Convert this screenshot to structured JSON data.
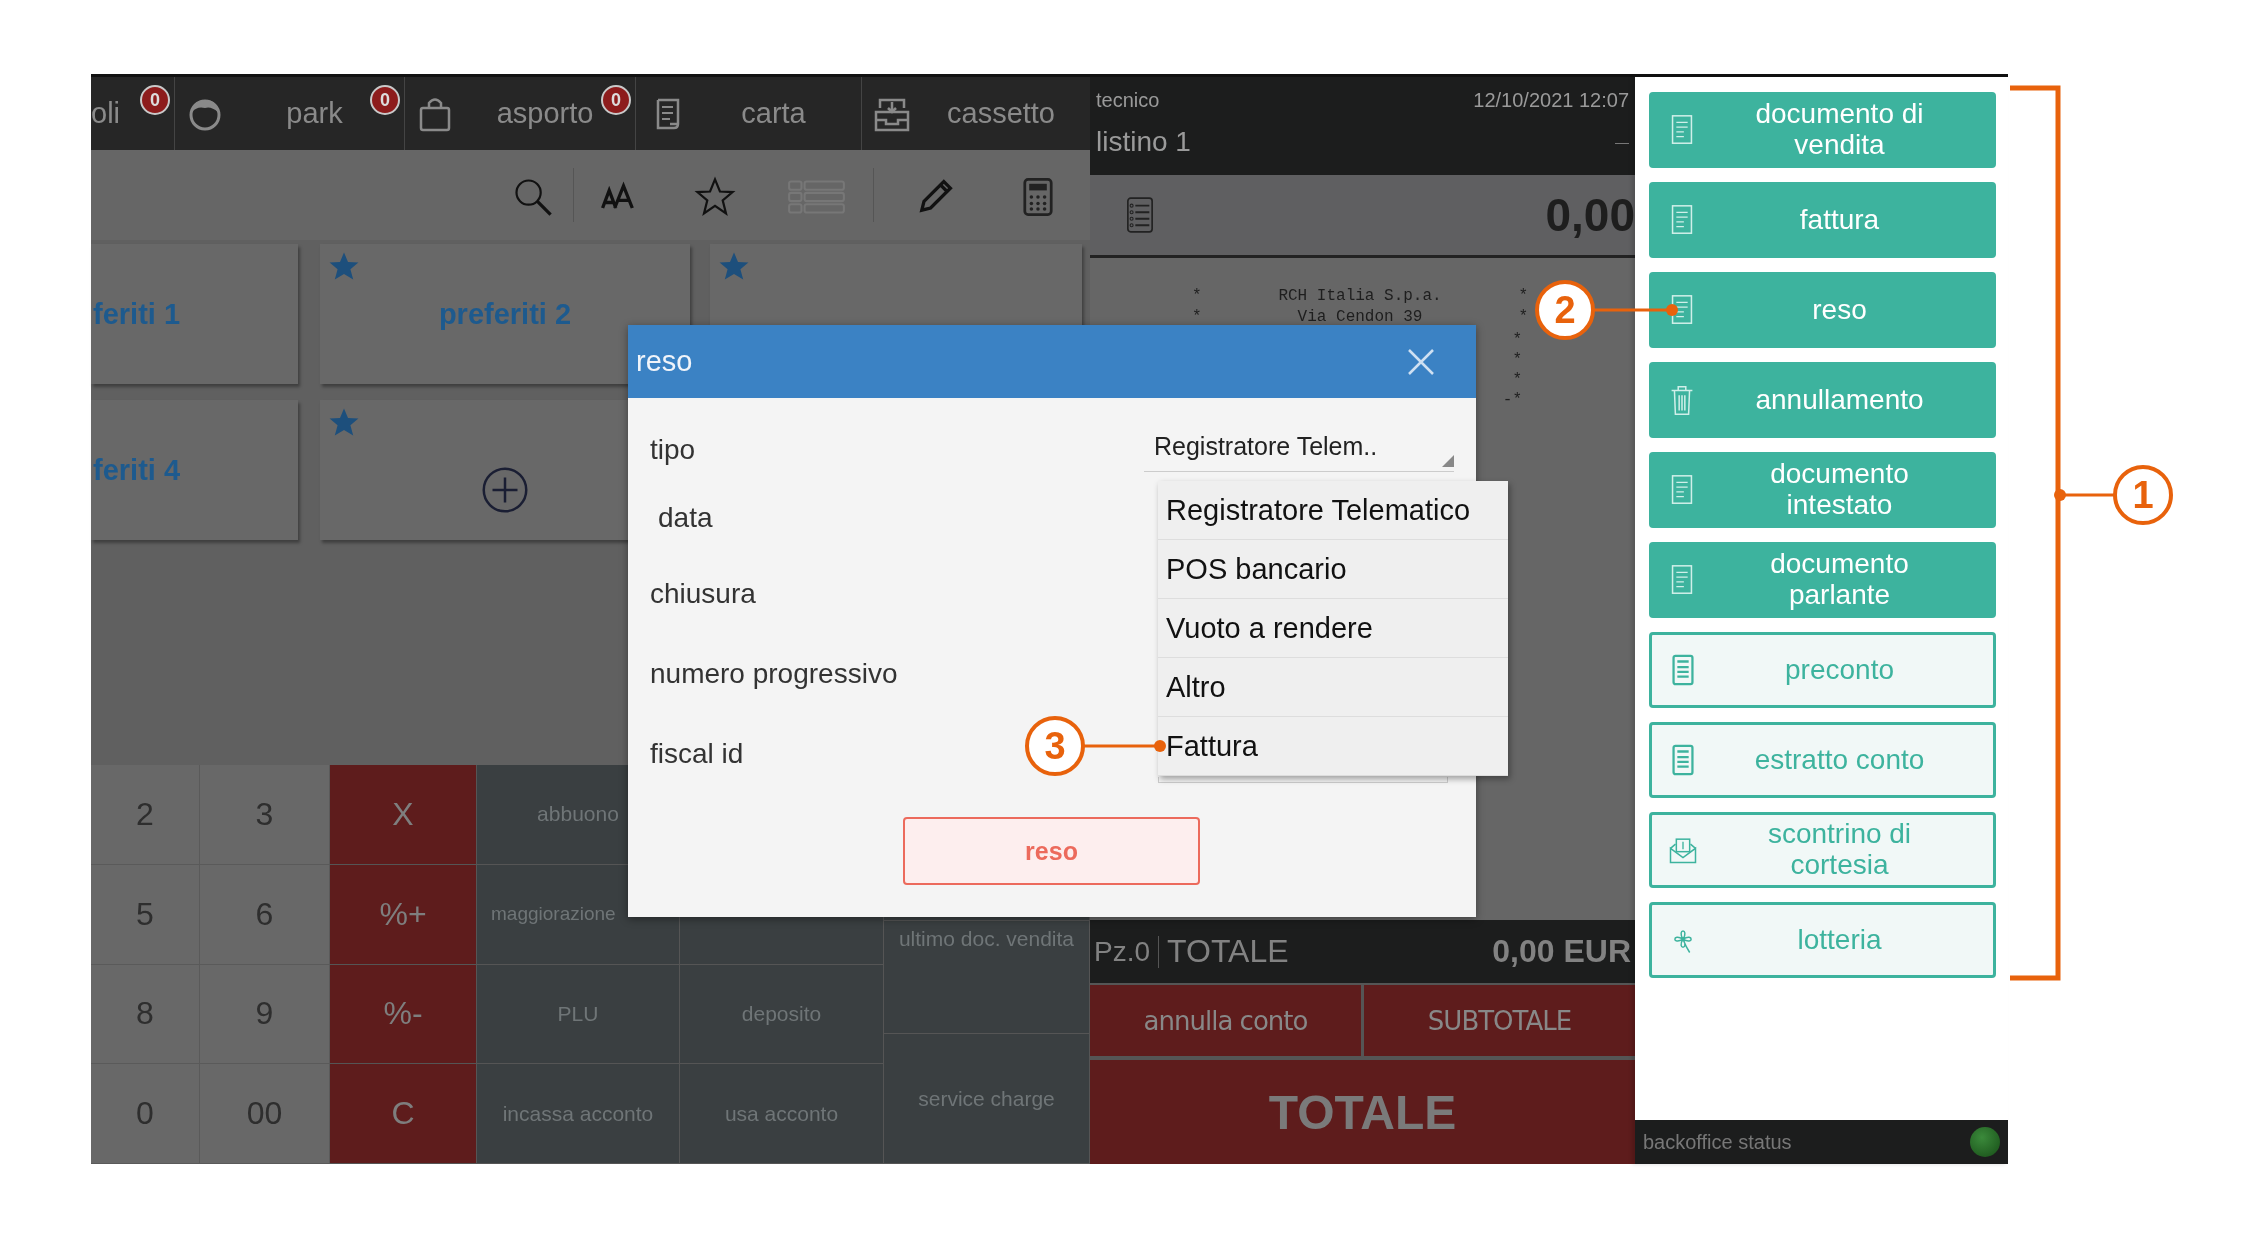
{
  "top_bar": {
    "tabs": [
      {
        "label": "oli",
        "badge": "0"
      },
      {
        "label": "park",
        "badge": "0"
      },
      {
        "label": "asporto",
        "badge": "0"
      },
      {
        "label": "carta"
      },
      {
        "label": "cassetto"
      }
    ]
  },
  "tiles": [
    {
      "label": "feriti 1",
      "starred": false
    },
    {
      "label": "preferiti 2",
      "starred": true
    },
    {
      "starred": true
    },
    {
      "label": "feriti 4",
      "starred": false
    },
    {
      "kind": "add",
      "starred": true
    }
  ],
  "keypad": {
    "keys": [
      {
        "label": "2",
        "kind": "digit"
      },
      {
        "label": "3",
        "kind": "digit"
      },
      {
        "label": "X",
        "kind": "operator"
      },
      {
        "label": "5",
        "kind": "digit"
      },
      {
        "label": "6",
        "kind": "digit"
      },
      {
        "label": "%+",
        "kind": "operator"
      },
      {
        "label": "8",
        "kind": "digit"
      },
      {
        "label": "9",
        "kind": "digit"
      },
      {
        "label": "%-",
        "kind": "operator"
      },
      {
        "label": "0",
        "kind": "digit"
      },
      {
        "label": "00",
        "kind": "digit"
      },
      {
        "label": "C",
        "kind": "operator"
      }
    ],
    "functions": [
      "abbuono",
      "maggiorazione",
      "PLU",
      "deposito",
      "incassa acconto",
      "usa acconto"
    ],
    "side_functions": [
      "ultimo doc. vendita",
      "service charge"
    ]
  },
  "receipt": {
    "user": "tecnico",
    "datetime": "12/10/2021 12:07",
    "price_list": "listino 1",
    "price_list_mark": "—",
    "amount": "0,00",
    "lines": [
      "*        RCH Italia S.p.a.        *",
      "*          Via Cendon 39          *"
    ],
    "line_ends": [
      "*",
      "*",
      "*",
      "-*"
    ],
    "pieces": "Pz.0",
    "total_label": "TOTALE",
    "total": "0,00 EUR",
    "buttons": [
      "annulla conto",
      "SUBTOTALE"
    ],
    "total_button": "TOTALE"
  },
  "documents": [
    {
      "label": "documento di vendita",
      "kind": "filled"
    },
    {
      "label": "fattura",
      "kind": "filled"
    },
    {
      "label": "reso",
      "kind": "filled"
    },
    {
      "label": "annullamento",
      "kind": "filled"
    },
    {
      "label": "documento intestato",
      "kind": "filled"
    },
    {
      "label": "documento parlante",
      "kind": "filled"
    },
    {
      "label": "preconto",
      "kind": "outlined"
    },
    {
      "label": "estratto conto",
      "kind": "outlined"
    },
    {
      "label": "scontrino di cortesia",
      "kind": "outlined"
    },
    {
      "label": "lotteria",
      "kind": "outlined"
    }
  ],
  "status_bar": {
    "label": "backoffice status"
  },
  "dialog": {
    "title": "reso",
    "fields": [
      {
        "label": "tipo",
        "value": "Registratore Telem.."
      },
      {
        "label": "data"
      },
      {
        "label": "chiusura"
      },
      {
        "label": "numero progressivo"
      },
      {
        "label": "fiscal id"
      }
    ],
    "options": [
      {
        "label": "Registratore Telematico",
        "selected": false
      },
      {
        "label": "POS bancario",
        "selected": false
      },
      {
        "label": "Vuoto a rendere",
        "selected": false
      },
      {
        "label": "Altro",
        "selected": false
      },
      {
        "label": "Fattura",
        "selected": false
      }
    ],
    "button": "reso"
  },
  "callouts": [
    "1",
    "2",
    "3"
  ]
}
